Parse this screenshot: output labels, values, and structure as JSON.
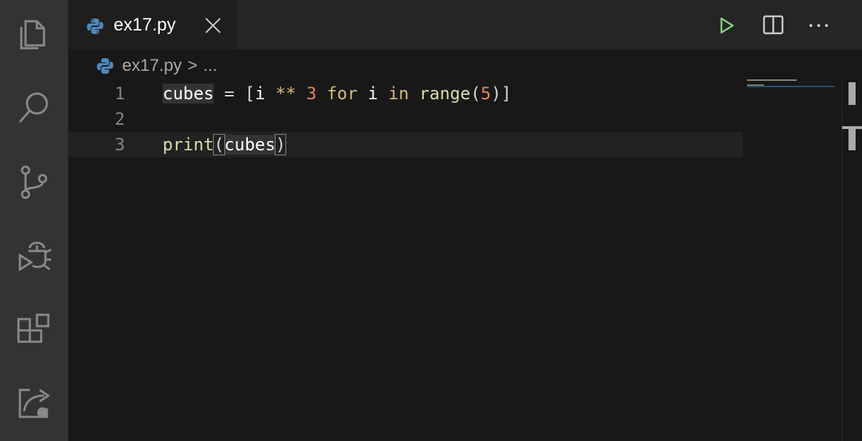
{
  "activity_bar": {
    "items": [
      {
        "name": "explorer-icon"
      },
      {
        "name": "search-icon"
      },
      {
        "name": "source-control-icon"
      },
      {
        "name": "run-debug-icon"
      },
      {
        "name": "extensions-icon"
      },
      {
        "name": "remote-explorer-icon"
      }
    ]
  },
  "tab": {
    "label": "ex17.py",
    "icon": "python-icon"
  },
  "toolbar": {
    "run_icon": "play-icon",
    "split_icon": "split-editor-icon",
    "more_icon": "more-actions-icon"
  },
  "breadcrumb": {
    "file": "ex17.py",
    "separator": ">",
    "more": "..."
  },
  "editor": {
    "line_numbers": [
      "1",
      "2",
      "3"
    ],
    "lines": {
      "l1": {
        "var": "cubes",
        "eq": " = ",
        "open": "[",
        "i1": "i ",
        "pow": "**",
        "sp1": " ",
        "num3": "3",
        "sp2": " ",
        "for": "for",
        "i2": " i ",
        "in": "in",
        "sp3": " ",
        "range": "range",
        "paren_open": "(",
        "num5": "5",
        "paren_close": ")",
        "close": "]"
      },
      "l3": {
        "print": "print",
        "paren_open": "(",
        "arg": "cubes",
        "paren_close": ")"
      }
    }
  },
  "colors": {
    "background": "#181818",
    "activity_bar": "#333333",
    "keyword": "#d7ba7d",
    "number": "#e8815b",
    "function": "#dcdcaa",
    "run_green": "#89d185"
  }
}
